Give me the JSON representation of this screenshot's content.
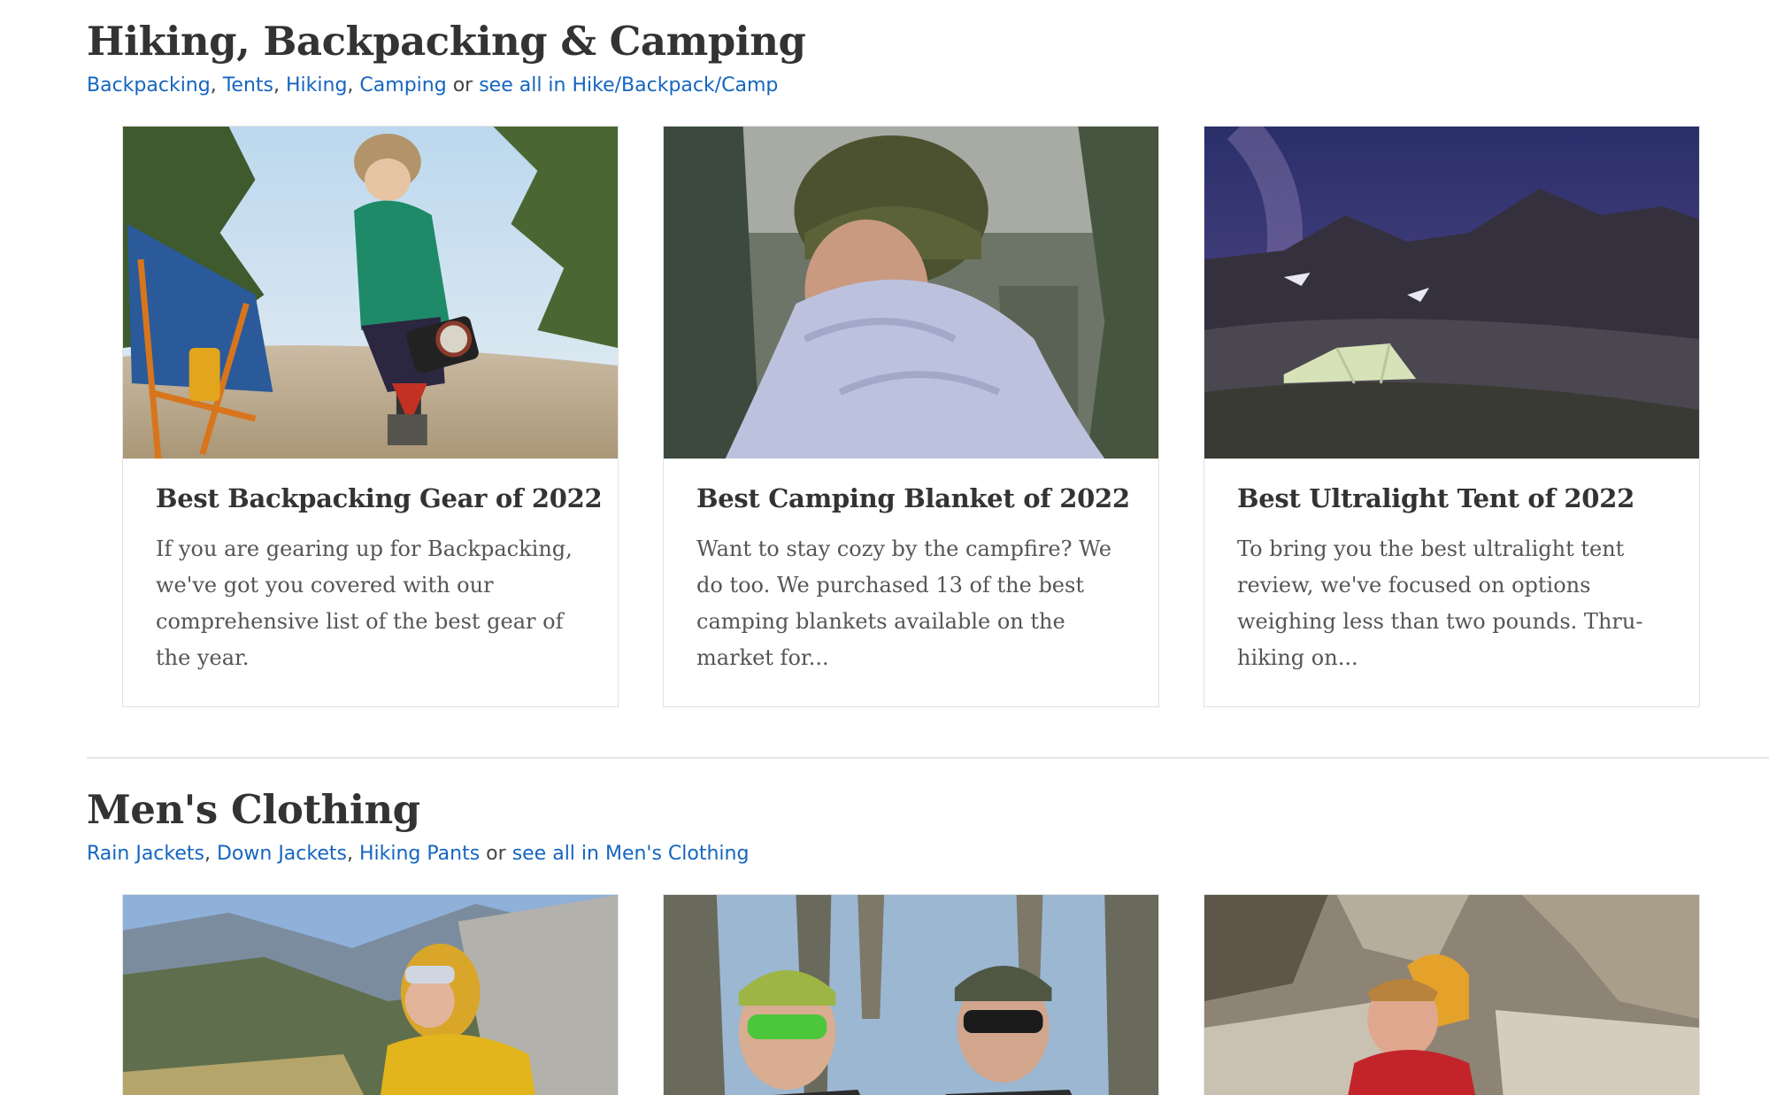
{
  "sections": [
    {
      "title": "Hiking, Backpacking & Camping",
      "links": [
        "Backpacking",
        "Tents",
        "Hiking",
        "Camping"
      ],
      "separator": ",",
      "or_text": "or",
      "see_all": "see all in Hike/Backpack/Camp",
      "cards": [
        {
          "title": "Best Backpacking Gear of 2022",
          "excerpt": "If you are gearing up for Backpacking, we've got you covered with our comprehensive list of the best gear of the year.",
          "image": "woman-camp-stove-photo"
        },
        {
          "title": "Best Camping Blanket of 2022",
          "excerpt": "Want to stay cozy by the campfire? We do too. We purchased 13 of the best camping blankets available on the market for...",
          "image": "woman-wrapped-in-blanket-photo"
        },
        {
          "title": "Best Ultralight Tent of 2022",
          "excerpt": "To bring you the best ultralight tent review, we've focused on options weighing less than two pounds. Thru-hiking on...",
          "image": "tent-under-night-sky-photo"
        }
      ]
    },
    {
      "title": "Men's Clothing",
      "links": [
        "Rain Jackets",
        "Down Jackets",
        "Hiking Pants"
      ],
      "separator": ",",
      "or_text": "or",
      "see_all": "see all in Men's Clothing",
      "cards": [
        {
          "image": "man-yellow-down-jacket-photo"
        },
        {
          "image": "two-men-sunglasses-photo"
        },
        {
          "image": "man-red-jacket-climbing-photo"
        }
      ]
    }
  ],
  "colors": {
    "link": "#1565c0",
    "heading": "#333333",
    "body_text": "#555555",
    "card_border": "#e2e2e2"
  }
}
